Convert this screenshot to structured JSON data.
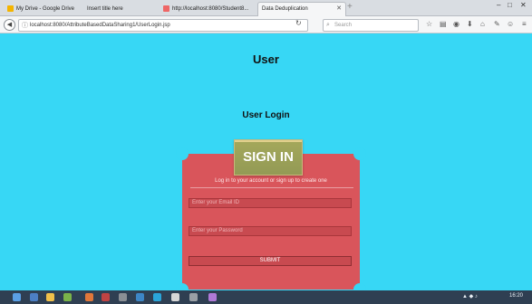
{
  "browser": {
    "tabs": [
      {
        "title": "My Drive - Google Drive",
        "active": false
      },
      {
        "title": "Insert title here",
        "active": false
      },
      {
        "title": "http://localhost:8080/Student8...",
        "active": false
      },
      {
        "title": "Data Deduplication",
        "active": true
      }
    ],
    "new_tab": "+",
    "url": "localhost:8080/AttributeBasedDataSharing1/UserLogin.jsp",
    "search_placeholder": "Search",
    "window_controls": {
      "minimize": "–",
      "maximize": "□",
      "close": "✕"
    }
  },
  "page": {
    "heading": "User",
    "login_heading": "User Login",
    "signin": {
      "title": "SIGN IN",
      "subtitle": "Log in to your account or sign up to create one",
      "email_placeholder": "Enter your Email ID",
      "password_placeholder": "Enter your Password",
      "submit_label": "SUBMIT"
    }
  },
  "taskbar": {
    "clock": "16:20"
  },
  "colors": {
    "page_background": "#37d7f5",
    "card": "#d9555b",
    "signin_box": "#9fa55a"
  }
}
